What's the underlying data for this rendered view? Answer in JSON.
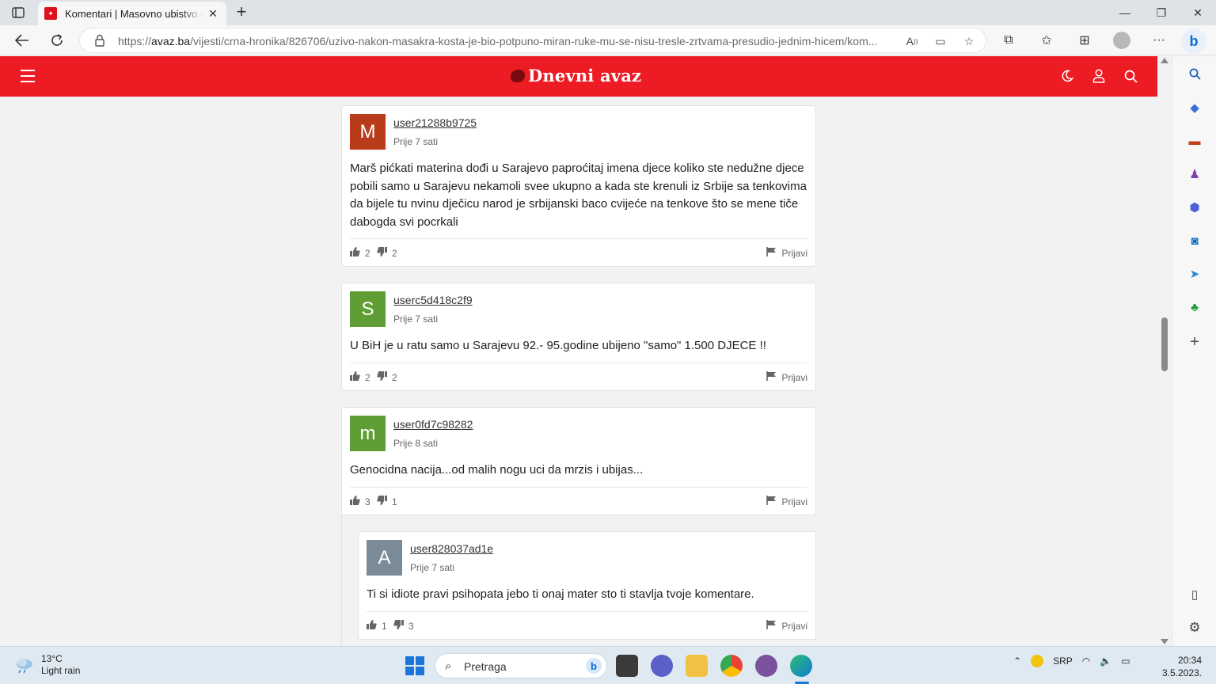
{
  "browser": {
    "tab_title": "Komentari | Masovno ubistvo u je",
    "url_prefix": "https://",
    "url_host": "avaz.ba",
    "url_path": "/vijesti/crna-hronika/826706/uzivo-nakon-masakra-kosta-je-bio-potpuno-miran-ruke-mu-se-nisu-tresle-zrtvama-presudio-jednim-hicem/kom..."
  },
  "site": {
    "logo": "Dnevni avaz",
    "brand_color": "#ed1c24"
  },
  "comments": [
    {
      "avatar_letter": "M",
      "avatar_color": "#b83b1a",
      "username": "user21288b9725",
      "time": "Prije 7 sati",
      "text": "Marš pićkati materina dođi u Sarajevo paproćitaj imena djece koliko ste nedužne djece pobili samo u Sarajevu nekamoli svee ukupno a kada ste krenuli iz Srbije sa tenkovima da bijele tu nvinu dječicu narod je srbijanski baco cvijeće na tenkove što se mene tiče dabogda svi pocrkali",
      "likes": "2",
      "dislikes": "2",
      "report": "Prijavi"
    },
    {
      "avatar_letter": "S",
      "avatar_color": "#5e9e34",
      "username": "userc5d418c2f9",
      "time": "Prije 7 sati",
      "text": "U BiH je u ratu samo u Sarajevu 92.- 95.godine ubijeno \"samo\" 1.500 DJECE !!",
      "likes": "2",
      "dislikes": "2",
      "report": "Prijavi"
    },
    {
      "avatar_letter": "m",
      "avatar_color": "#5e9e34",
      "username": "user0fd7c98282",
      "time": "Prije 8 sati",
      "text": "Genocidna nacija...od malih nogu uci da mrzis i ubijas...",
      "likes": "3",
      "dislikes": "1",
      "report": "Prijavi"
    },
    {
      "avatar_letter": "A",
      "avatar_color": "#7a8a96",
      "username": "user828037ad1e",
      "time": "Prije 7 sati",
      "text": "Ti si idiote pravi psihopata jebo ti onaj mater sto ti stavlja tvoje komentare.",
      "likes": "1",
      "dislikes": "3",
      "report": "Prijavi"
    }
  ],
  "taskbar": {
    "temperature": "13°C",
    "weather": "Light rain",
    "search_placeholder": "Pretraga",
    "language": "SRP",
    "time": "20:34",
    "date": "3.5.2023."
  }
}
